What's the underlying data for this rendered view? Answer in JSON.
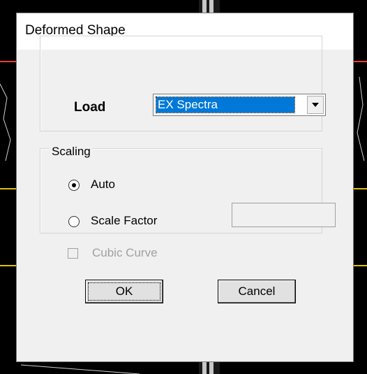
{
  "window": {
    "title": "Deformed Shape"
  },
  "load": {
    "label": "Load",
    "selected": "EX Spectra"
  },
  "scaling": {
    "group_title": "Scaling",
    "options": [
      {
        "label": "Auto",
        "checked": true
      },
      {
        "label": "Scale Factor",
        "checked": false
      }
    ],
    "scale_factor_value": ""
  },
  "cubic_curve": {
    "label": "Cubic Curve",
    "checked": false,
    "enabled": false
  },
  "buttons": {
    "ok": "OK",
    "cancel": "Cancel"
  },
  "colors": {
    "selection": "#0078d7",
    "dialog_bg": "#f0f0f0",
    "disabled_text": "#a0a0a0"
  }
}
